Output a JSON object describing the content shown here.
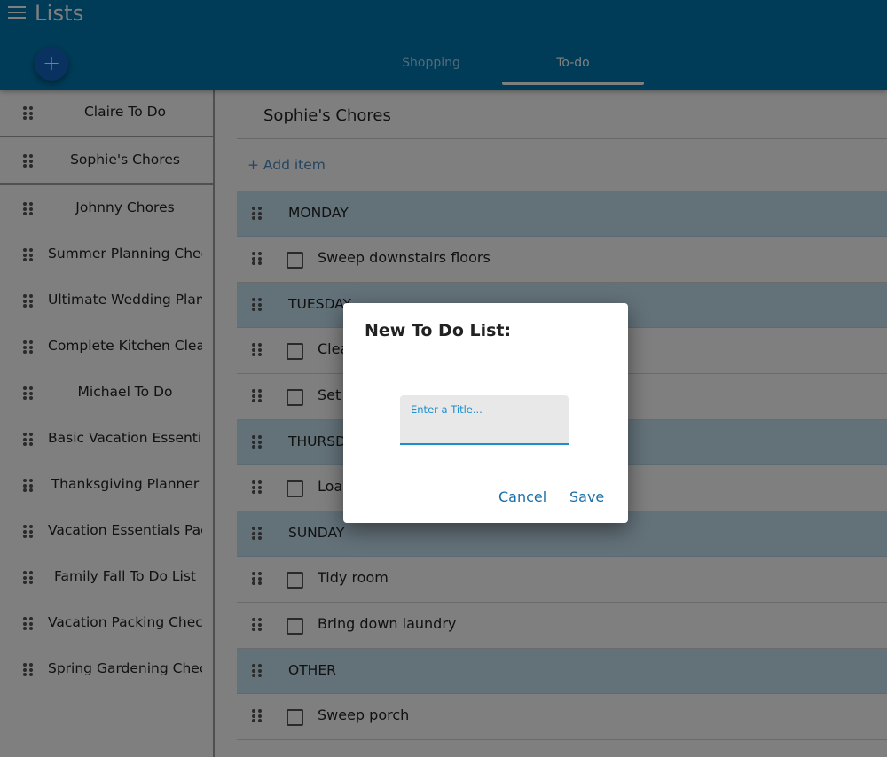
{
  "app": {
    "title": "Lists",
    "menu_icon": "hamburger-menu-icon",
    "fab_label": "+",
    "tabs": [
      {
        "label": "Shopping",
        "active": false
      },
      {
        "label": "To-do",
        "active": true
      }
    ]
  },
  "sidebar": {
    "items": [
      {
        "label": "Claire To Do"
      },
      {
        "label": "Sophie's Chores",
        "selected": true
      },
      {
        "label": "Johnny Chores"
      },
      {
        "label": "Summer Planning Checklist"
      },
      {
        "label": "Ultimate Wedding Planner"
      },
      {
        "label": "Complete Kitchen Cleaning"
      },
      {
        "label": "Michael To Do"
      },
      {
        "label": "Basic Vacation Essentials"
      },
      {
        "label": "Thanksgiving Planner"
      },
      {
        "label": "Vacation Essentials Packing"
      },
      {
        "label": "Family Fall To Do List"
      },
      {
        "label": "Vacation Packing Checklist"
      },
      {
        "label": "Spring Gardening Checklist"
      }
    ]
  },
  "main": {
    "list_title": "Sophie's Chores",
    "add_item_label": "+ Add item",
    "rows": [
      {
        "type": "section",
        "label": "MONDAY"
      },
      {
        "type": "item",
        "label": "Sweep downstairs floors",
        "checked": false
      },
      {
        "type": "section",
        "label": "TUESDAY"
      },
      {
        "type": "item",
        "label": "Clea",
        "checked": false
      },
      {
        "type": "item",
        "label": "Set",
        "checked": false
      },
      {
        "type": "section",
        "label": "THURSDAY"
      },
      {
        "type": "item",
        "label": "Load",
        "checked": false
      },
      {
        "type": "section",
        "label": "SUNDAY"
      },
      {
        "type": "item",
        "label": "Tidy room",
        "checked": false
      },
      {
        "type": "item",
        "label": "Bring down laundry",
        "checked": false
      },
      {
        "type": "section",
        "label": "OTHER"
      },
      {
        "type": "item",
        "label": "Sweep porch",
        "checked": false
      }
    ]
  },
  "dialog": {
    "title": "New To Do List:",
    "field_label": "Enter a Title...",
    "field_value": "",
    "cancel_label": "Cancel",
    "save_label": "Save"
  },
  "colors": {
    "appbar": "#0078b0",
    "fab": "#1565c0",
    "section_bg": "#c6e3f3",
    "accent": "#1a8fd0"
  }
}
